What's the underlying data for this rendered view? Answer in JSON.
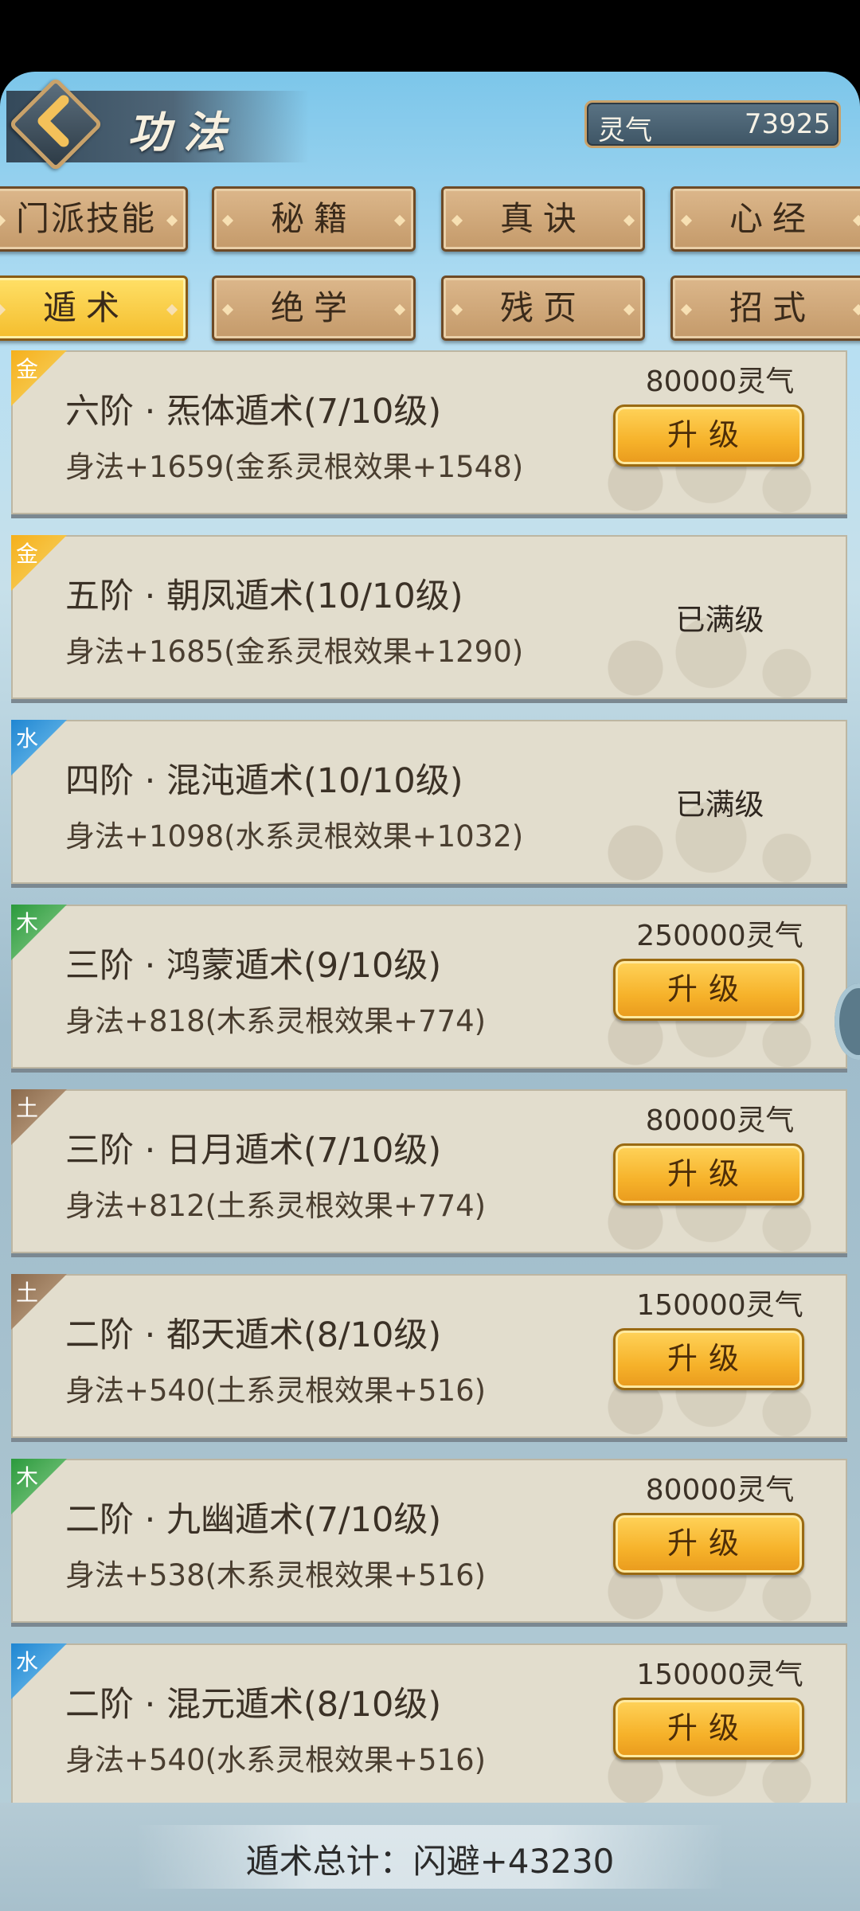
{
  "header": {
    "title": "功法",
    "currency_label": "灵气",
    "currency_value": "73925"
  },
  "tabs": [
    {
      "label": "门派技能",
      "active": false
    },
    {
      "label": "秘籍",
      "active": false
    },
    {
      "label": "真诀",
      "active": false
    },
    {
      "label": "心经",
      "active": false
    },
    {
      "label": "遁术",
      "active": true
    },
    {
      "label": "绝学",
      "active": false
    },
    {
      "label": "残页",
      "active": false
    },
    {
      "label": "招式",
      "active": false
    }
  ],
  "skills": [
    {
      "element": "金",
      "name": "六阶 · 炁体遁术(7/10级)",
      "effect": "身法+1659(金系灵根效果+1548)",
      "cost": "80000灵气",
      "action": "升级"
    },
    {
      "element": "金",
      "name": "五阶 · 朝凤遁术(10/10级)",
      "effect": "身法+1685(金系灵根效果+1290)",
      "status": "已满级"
    },
    {
      "element": "水",
      "name": "四阶 · 混沌遁术(10/10级)",
      "effect": "身法+1098(水系灵根效果+1032)",
      "status": "已满级"
    },
    {
      "element": "木",
      "name": "三阶 · 鸿蒙遁术(9/10级)",
      "effect": "身法+818(木系灵根效果+774)",
      "cost": "250000灵气",
      "action": "升级"
    },
    {
      "element": "土",
      "name": "三阶 · 日月遁术(7/10级)",
      "effect": "身法+812(土系灵根效果+774)",
      "cost": "80000灵气",
      "action": "升级"
    },
    {
      "element": "土",
      "name": "二阶 · 都天遁术(8/10级)",
      "effect": "身法+540(土系灵根效果+516)",
      "cost": "150000灵气",
      "action": "升级"
    },
    {
      "element": "木",
      "name": "二阶 · 九幽遁术(7/10级)",
      "effect": "身法+538(木系灵根效果+516)",
      "cost": "80000灵气",
      "action": "升级"
    },
    {
      "element": "水",
      "name": "二阶 · 混元遁术(8/10级)",
      "effect": "身法+540(水系灵根效果+516)",
      "cost": "150000灵气",
      "action": "升级"
    }
  ],
  "footer": {
    "summary": "遁术总计：闪避+43230"
  },
  "colors": {
    "gold": "#f5b01c",
    "water": "#1f86d2",
    "wood": "#2b9a3d",
    "earth": "#8b6a4c",
    "active_tab": "#f4bd2d"
  }
}
